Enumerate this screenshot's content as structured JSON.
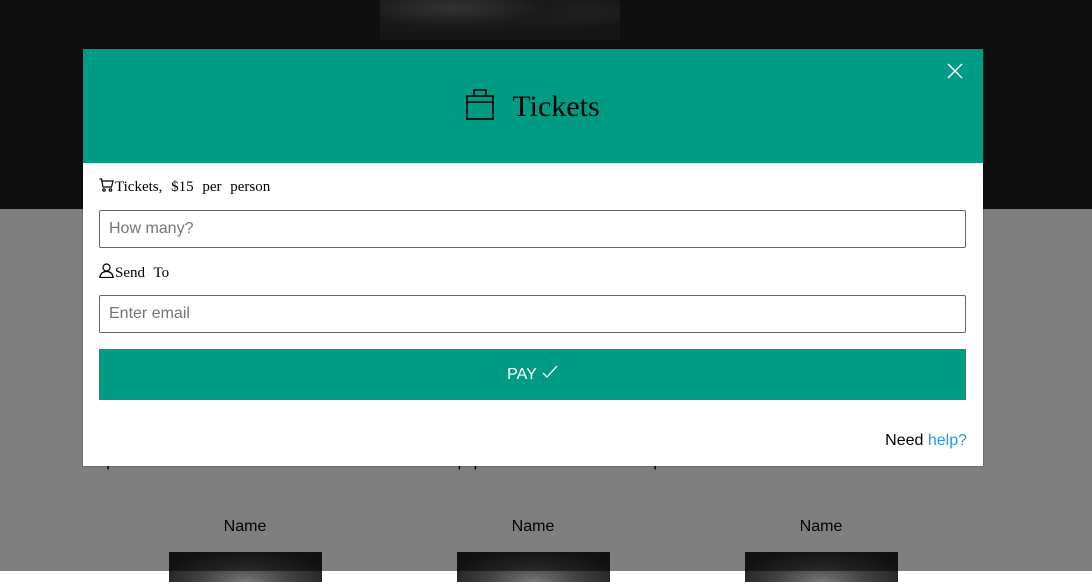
{
  "background": {
    "body_text": "quis nostrud exercitation ullamco laboris nisi ut aliquip ex ea commodo consequat.",
    "team": [
      {
        "name": "Name"
      },
      {
        "name": "Name"
      },
      {
        "name": "Name"
      }
    ]
  },
  "modal": {
    "title": "Tickets",
    "title_icon": "briefcase-icon",
    "close_icon": "close-icon",
    "tickets_label": "Tickets, $15 per person",
    "tickets_icon": "shopping-cart-icon",
    "quantity_placeholder": "How many?",
    "quantity_value": "",
    "send_to_label": "Send To",
    "send_to_icon": "user-icon",
    "email_placeholder": "Enter email",
    "email_value": "",
    "pay_label": "PAY",
    "pay_icon": "checkmark-icon",
    "help_prefix": "Need",
    "help_link": "help?"
  },
  "colors": {
    "accent": "#009b85",
    "link": "#2196f3",
    "overlay": "rgba(0,0,0,0.5)"
  }
}
